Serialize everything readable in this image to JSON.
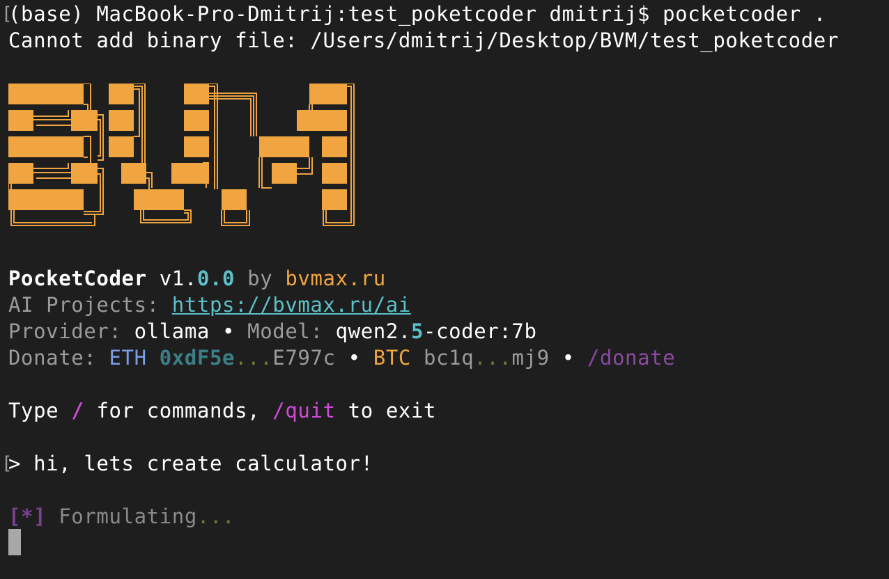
{
  "terminal": {
    "prompt_line": "(base) MacBook-Pro-Dmitrij:test_poketcoder dmitrij$ pocketcoder .",
    "error_line": "Cannot add binary file: /Users/dmitrij/Desktop/BVM/test_poketcoder",
    "line_marker": "[",
    "logo_name": "BVM ascii-block logo",
    "logo_color": "#f0a540",
    "app": {
      "name": "PocketCoder",
      "version_prefix": "v1.",
      "version_suffix": "0.0",
      "by": "by",
      "site": "bvmax.ru"
    },
    "projects": {
      "label": "AI Projects:",
      "url": "https://bvmax.ru/ai"
    },
    "provider": {
      "label": "Provider:",
      "value": "ollama",
      "sep": "•",
      "model_label": "Model:",
      "model_a": "qwen2.",
      "model_b": "5",
      "model_c": "-coder:7b"
    },
    "donate": {
      "label": "Donate:",
      "eth_label": "ETH",
      "eth_start": "0xdF5e",
      "eth_dots": "...",
      "eth_end": "E797c",
      "sep": "•",
      "btc_label": "BTC",
      "btc_start": "bc1q",
      "btc_dots": "...",
      "btc_end": "mj9",
      "sep2": "•",
      "command": "/donate"
    },
    "hint": {
      "type": "Type",
      "slash": "/",
      "for": "for commands,",
      "quit": "/quit",
      "to_exit": "to exit"
    },
    "input": {
      "caret": ">",
      "text": "hi, lets create calculator!"
    },
    "status": {
      "bracket": "[*]",
      "text": "Formulating",
      "dots": "..."
    }
  }
}
